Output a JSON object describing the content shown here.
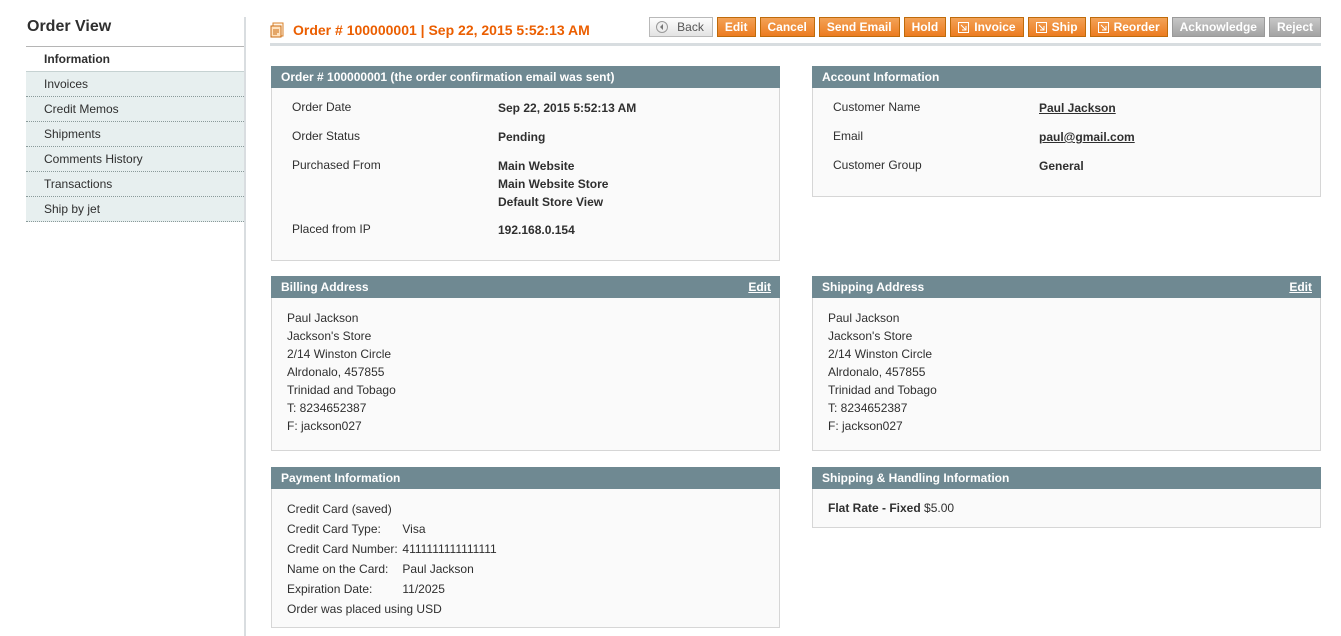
{
  "sidebar": {
    "title": "Order View",
    "tabs": [
      {
        "label": "Information",
        "active": true
      },
      {
        "label": "Invoices"
      },
      {
        "label": "Credit Memos"
      },
      {
        "label": "Shipments"
      },
      {
        "label": "Comments History"
      },
      {
        "label": "Transactions"
      },
      {
        "label": "Ship by jet"
      }
    ]
  },
  "header": {
    "title": "Order # 100000001 | Sep 22, 2015 5:52:13 AM",
    "icon": "order-icon",
    "buttons": {
      "back": "Back",
      "edit": "Edit",
      "cancel": "Cancel",
      "send_email": "Send Email",
      "hold": "Hold",
      "invoice": "Invoice",
      "ship": "Ship",
      "reorder": "Reorder",
      "acknowledge": "Acknowledge",
      "reject": "Reject"
    }
  },
  "order_info": {
    "heading": "Order # 100000001 (the order confirmation email was sent)",
    "order_date_label": "Order Date",
    "order_date": "Sep 22, 2015 5:52:13 AM",
    "status_label": "Order Status",
    "status": "Pending",
    "purchased_from_label": "Purchased From",
    "purchased_from": [
      "Main Website",
      "Main Website Store",
      "Default Store View"
    ],
    "ip_label": "Placed from IP",
    "ip": "192.168.0.154"
  },
  "account_info": {
    "heading": "Account Information",
    "name_label": "Customer Name",
    "name": "Paul Jackson",
    "email_label": "Email",
    "email": "paul@gmail.com",
    "group_label": "Customer Group",
    "group": "General"
  },
  "billing": {
    "heading": "Billing Address",
    "edit": "Edit",
    "lines": [
      "Paul Jackson",
      "Jackson's Store",
      "2/14 Winston Circle",
      "Alrdonalo, 457855",
      "Trinidad and Tobago",
      "T: 8234652387",
      "F: jackson027"
    ]
  },
  "shipping": {
    "heading": "Shipping Address",
    "edit": "Edit",
    "lines": [
      "Paul Jackson",
      "Jackson's Store",
      "2/14 Winston Circle",
      "Alrdonalo, 457855",
      "Trinidad and Tobago",
      "T: 8234652387",
      "F: jackson027"
    ]
  },
  "payment": {
    "heading": "Payment Information",
    "method": "Credit Card (saved)",
    "type_label": "Credit Card Type:",
    "type": "Visa",
    "number_label": "Credit Card Number:",
    "number": "4111111111111111",
    "name_label": "Name on the Card:",
    "name": "Paul Jackson",
    "exp_label": "Expiration Date:",
    "exp": "11/2025",
    "currency_note": "Order was placed using USD"
  },
  "shipping_handling": {
    "heading": "Shipping & Handling Information",
    "method": "Flat Rate - Fixed",
    "price": "$5.00"
  },
  "colors": {
    "accent": "#eb5e00",
    "box_header": "#6f8992",
    "button_orange": "#ec7c21",
    "button_grey": "#a3a3a3",
    "tab_bg": "#e7efef"
  }
}
